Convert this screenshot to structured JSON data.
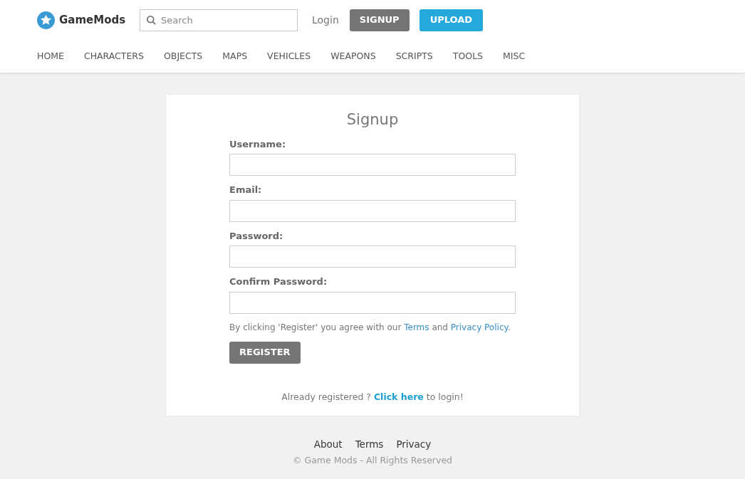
{
  "header": {
    "brand": "GameMods",
    "search": {
      "placeholder": "Search"
    },
    "login": "Login",
    "signup": "SIGNUP",
    "upload": "UPLOAD"
  },
  "nav": [
    "HOME",
    "CHARACTERS",
    "OBJECTS",
    "MAPS",
    "VEHICLES",
    "WEAPONS",
    "SCRIPTS",
    "TOOLS",
    "MISC"
  ],
  "form": {
    "title": "Signup",
    "fields": [
      {
        "label": "Username:"
      },
      {
        "label": "Email:"
      },
      {
        "label": "Password:"
      },
      {
        "label": "Confirm Password:"
      }
    ],
    "agreement": {
      "before": "By clicking 'Register' you agree with our",
      "terms": "Terms",
      "middle": "and",
      "privacy": "Privacy Policy",
      "after": "."
    },
    "register": "REGISTER",
    "login_prompt": {
      "before": "Already registered ?",
      "link": "Click here",
      "after": "to login!"
    }
  },
  "footer": {
    "links": [
      "About",
      "Terms",
      "Privacy"
    ],
    "copyright": "© Game Mods - All Rights Reserved"
  }
}
